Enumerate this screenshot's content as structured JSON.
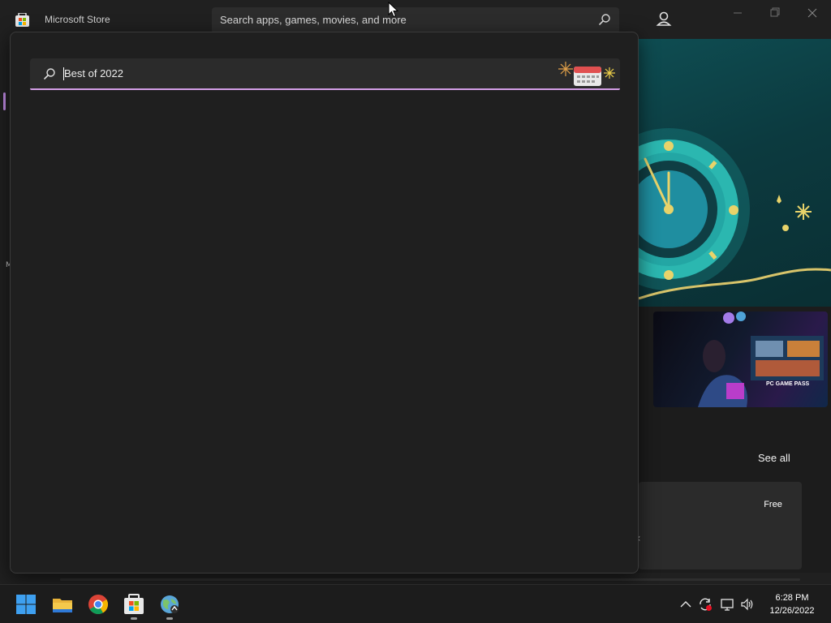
{
  "window": {
    "app_title": "Microsoft Store",
    "search_placeholder": "Search apps, games, movies, and more"
  },
  "flyout": {
    "search_value": "Best of 2022",
    "accent_color": "#d39ee6"
  },
  "background_page": {
    "nav_letter": "M",
    "gamepass_label": "PC GAME PASS",
    "see_all_label": "See all",
    "price_badge": "Free"
  },
  "taskbar": {
    "pinned": [
      "windows-start-icon",
      "file-explorer-icon",
      "chrome-icon",
      "microsoft-store-icon",
      "web-browser-icon"
    ],
    "tray": [
      "chevron-up-icon",
      "sync-icon",
      "network-icon",
      "volume-icon"
    ],
    "time": "6:28 PM",
    "date": "12/26/2022"
  }
}
